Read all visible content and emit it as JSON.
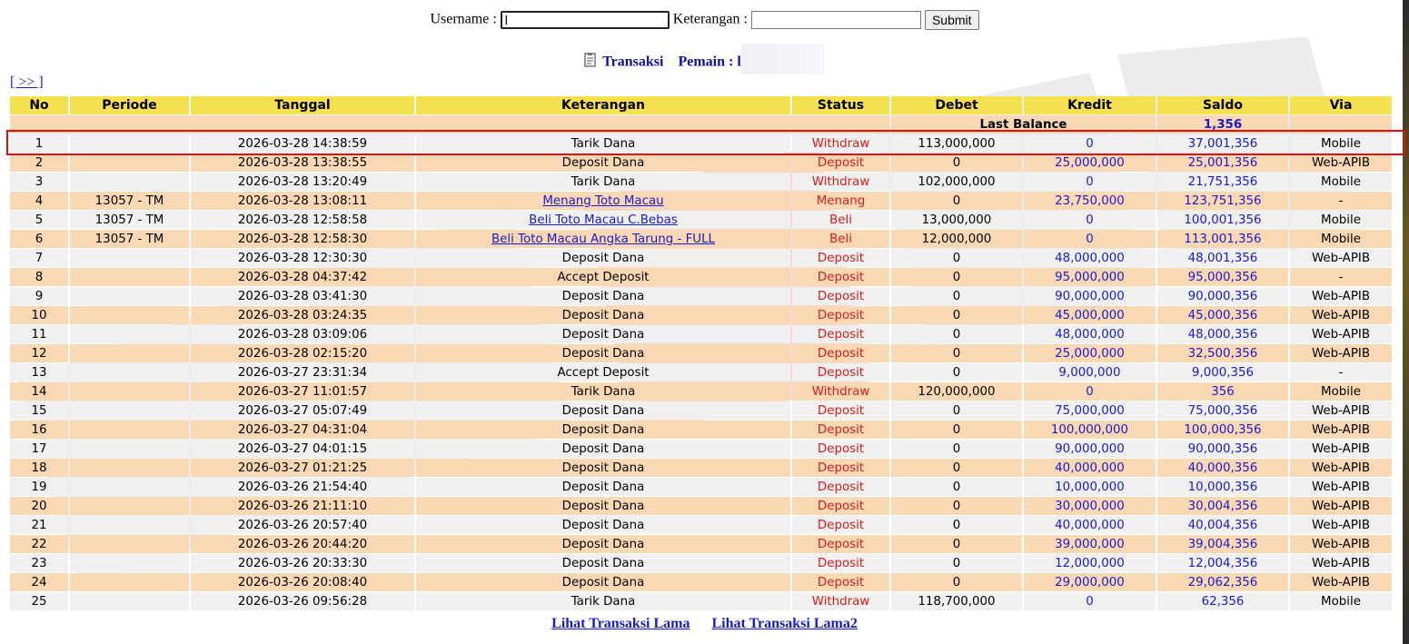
{
  "form": {
    "username_label": "Username :",
    "username_value": "l",
    "keterangan_label": "Keterangan :",
    "keterangan_value": "",
    "submit_label": "Submit"
  },
  "subhead": {
    "transaksi_label": "Transaksi",
    "pemain_label": "Pemain : l"
  },
  "nav": {
    "next_label": "[ >> ]"
  },
  "table": {
    "headers": [
      "No",
      "Periode",
      "Tanggal",
      "Keterangan",
      "Status",
      "Debet",
      "Kredit",
      "Saldo",
      "Via"
    ],
    "last_balance_label": "Last Balance",
    "last_balance_value": "1,356",
    "rows": [
      {
        "no": "1",
        "periode": "",
        "tanggal": "2026-03-28 14:38:59",
        "keterangan": "Tarik Dana",
        "link": false,
        "status": "Withdraw",
        "debet": "113,000,000",
        "kredit": "0",
        "saldo": "37,001,356",
        "via": "Mobile"
      },
      {
        "no": "2",
        "periode": "",
        "tanggal": "2026-03-28 13:38:55",
        "keterangan": "Deposit Dana",
        "link": false,
        "status": "Deposit",
        "debet": "0",
        "kredit": "25,000,000",
        "saldo": "25,001,356",
        "via": "Web-APIB"
      },
      {
        "no": "3",
        "periode": "",
        "tanggal": "2026-03-28 13:20:49",
        "keterangan": "Tarik Dana",
        "link": false,
        "status": "Withdraw",
        "debet": "102,000,000",
        "kredit": "0",
        "saldo": "21,751,356",
        "via": "Mobile"
      },
      {
        "no": "4",
        "periode": "13057 - TM",
        "tanggal": "2026-03-28 13:08:11",
        "keterangan": "Menang Toto Macau",
        "link": true,
        "status": "Menang",
        "debet": "0",
        "kredit": "23,750,000",
        "saldo": "123,751,356",
        "via": "-"
      },
      {
        "no": "5",
        "periode": "13057 - TM",
        "tanggal": "2026-03-28 12:58:58",
        "keterangan": "Beli Toto Macau C.Bebas",
        "link": true,
        "status": "Beli",
        "debet": "13,000,000",
        "kredit": "0",
        "saldo": "100,001,356",
        "via": "Mobile"
      },
      {
        "no": "6",
        "periode": "13057 - TM",
        "tanggal": "2026-03-28 12:58:30",
        "keterangan": "Beli Toto Macau Angka Tarung - FULL",
        "link": true,
        "status": "Beli",
        "debet": "12,000,000",
        "kredit": "0",
        "saldo": "113,001,356",
        "via": "Mobile"
      },
      {
        "no": "7",
        "periode": "",
        "tanggal": "2026-03-28 12:30:30",
        "keterangan": "Deposit Dana",
        "link": false,
        "status": "Deposit",
        "debet": "0",
        "kredit": "48,000,000",
        "saldo": "48,001,356",
        "via": "Web-APIB"
      },
      {
        "no": "8",
        "periode": "",
        "tanggal": "2026-03-28 04:37:42",
        "keterangan": "Accept Deposit",
        "link": false,
        "status": "Deposit",
        "debet": "0",
        "kredit": "95,000,000",
        "saldo": "95,000,356",
        "via": "-"
      },
      {
        "no": "9",
        "periode": "",
        "tanggal": "2026-03-28 03:41:30",
        "keterangan": "Deposit Dana",
        "link": false,
        "status": "Deposit",
        "debet": "0",
        "kredit": "90,000,000",
        "saldo": "90,000,356",
        "via": "Web-APIB"
      },
      {
        "no": "10",
        "periode": "",
        "tanggal": "2026-03-28 03:24:35",
        "keterangan": "Deposit Dana",
        "link": false,
        "status": "Deposit",
        "debet": "0",
        "kredit": "45,000,000",
        "saldo": "45,000,356",
        "via": "Web-APIB"
      },
      {
        "no": "11",
        "periode": "",
        "tanggal": "2026-03-28 03:09:06",
        "keterangan": "Deposit Dana",
        "link": false,
        "status": "Deposit",
        "debet": "0",
        "kredit": "48,000,000",
        "saldo": "48,000,356",
        "via": "Web-APIB"
      },
      {
        "no": "12",
        "periode": "",
        "tanggal": "2026-03-28 02:15:20",
        "keterangan": "Deposit Dana",
        "link": false,
        "status": "Deposit",
        "debet": "0",
        "kredit": "25,000,000",
        "saldo": "32,500,356",
        "via": "Web-APIB"
      },
      {
        "no": "13",
        "periode": "",
        "tanggal": "2026-03-27 23:31:34",
        "keterangan": "Accept Deposit",
        "link": false,
        "status": "Deposit",
        "debet": "0",
        "kredit": "9,000,000",
        "saldo": "9,000,356",
        "via": "-"
      },
      {
        "no": "14",
        "periode": "",
        "tanggal": "2026-03-27 11:01:57",
        "keterangan": "Tarik Dana",
        "link": false,
        "status": "Withdraw",
        "debet": "120,000,000",
        "kredit": "0",
        "saldo": "356",
        "via": "Mobile"
      },
      {
        "no": "15",
        "periode": "",
        "tanggal": "2026-03-27 05:07:49",
        "keterangan": "Deposit Dana",
        "link": false,
        "status": "Deposit",
        "debet": "0",
        "kredit": "75,000,000",
        "saldo": "75,000,356",
        "via": "Web-APIB"
      },
      {
        "no": "16",
        "periode": "",
        "tanggal": "2026-03-27 04:31:04",
        "keterangan": "Deposit Dana",
        "link": false,
        "status": "Deposit",
        "debet": "0",
        "kredit": "100,000,000",
        "saldo": "100,000,356",
        "via": "Web-APIB"
      },
      {
        "no": "17",
        "periode": "",
        "tanggal": "2026-03-27 04:01:15",
        "keterangan": "Deposit Dana",
        "link": false,
        "status": "Deposit",
        "debet": "0",
        "kredit": "90,000,000",
        "saldo": "90,000,356",
        "via": "Web-APIB"
      },
      {
        "no": "18",
        "periode": "",
        "tanggal": "2026-03-27 01:21:25",
        "keterangan": "Deposit Dana",
        "link": false,
        "status": "Deposit",
        "debet": "0",
        "kredit": "40,000,000",
        "saldo": "40,000,356",
        "via": "Web-APIB"
      },
      {
        "no": "19",
        "periode": "",
        "tanggal": "2026-03-26 21:54:40",
        "keterangan": "Deposit Dana",
        "link": false,
        "status": "Deposit",
        "debet": "0",
        "kredit": "10,000,000",
        "saldo": "10,000,356",
        "via": "Web-APIB"
      },
      {
        "no": "20",
        "periode": "",
        "tanggal": "2026-03-26 21:11:10",
        "keterangan": "Deposit Dana",
        "link": false,
        "status": "Deposit",
        "debet": "0",
        "kredit": "30,000,000",
        "saldo": "30,004,356",
        "via": "Web-APIB"
      },
      {
        "no": "21",
        "periode": "",
        "tanggal": "2026-03-26 20:57:40",
        "keterangan": "Deposit Dana",
        "link": false,
        "status": "Deposit",
        "debet": "0",
        "kredit": "40,000,000",
        "saldo": "40,004,356",
        "via": "Web-APIB"
      },
      {
        "no": "22",
        "periode": "",
        "tanggal": "2026-03-26 20:44:20",
        "keterangan": "Deposit Dana",
        "link": false,
        "status": "Deposit",
        "debet": "0",
        "kredit": "39,000,000",
        "saldo": "39,004,356",
        "via": "Web-APIB"
      },
      {
        "no": "23",
        "periode": "",
        "tanggal": "2026-03-26 20:33:30",
        "keterangan": "Deposit Dana",
        "link": false,
        "status": "Deposit",
        "debet": "0",
        "kredit": "12,000,000",
        "saldo": "12,004,356",
        "via": "Web-APIB"
      },
      {
        "no": "24",
        "periode": "",
        "tanggal": "2026-03-26 20:08:40",
        "keterangan": "Deposit Dana",
        "link": false,
        "status": "Deposit",
        "debet": "0",
        "kredit": "29,000,000",
        "saldo": "29,062,356",
        "via": "Web-APIB"
      },
      {
        "no": "25",
        "periode": "",
        "tanggal": "2026-03-26 09:56:28",
        "keterangan": "Tarik Dana",
        "link": false,
        "status": "Withdraw",
        "debet": "118,700,000",
        "kredit": "0",
        "saldo": "62,356",
        "via": "Mobile"
      }
    ]
  },
  "footer": {
    "link_lama": "Lihat Transaksi Lama",
    "link_lama2": "Lihat Transaksi Lama2"
  },
  "colors": {
    "header_bg": "#f5e14f",
    "row_odd": "#f0f0f0",
    "row_even": "#fbd8b4",
    "status_red": "#d81c1c",
    "link_blue": "#1a1ad0",
    "highlight_red": "#e01010"
  }
}
